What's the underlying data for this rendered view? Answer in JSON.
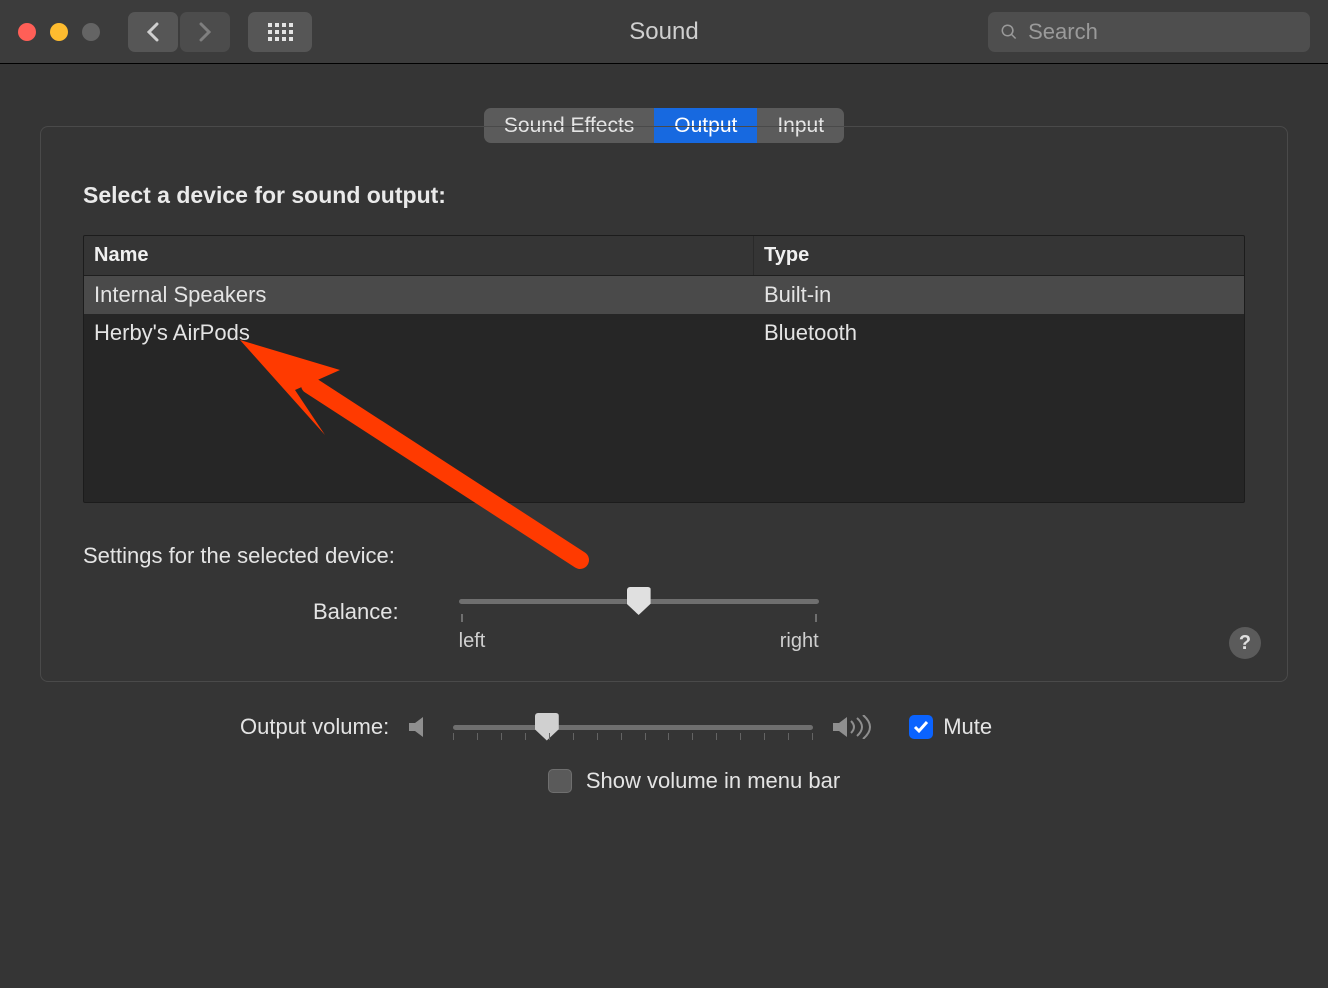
{
  "titlebar": {
    "title": "Sound",
    "search_placeholder": "Search"
  },
  "tabs": {
    "sound_effects": "Sound Effects",
    "output": "Output",
    "input": "Input"
  },
  "panel": {
    "select_device_heading": "Select a device for sound output:",
    "columns": {
      "name": "Name",
      "type": "Type"
    },
    "devices": [
      {
        "name": "Internal Speakers",
        "type": "Built-in",
        "selected": true
      },
      {
        "name": "Herby's AirPods",
        "type": "Bluetooth",
        "selected": false
      }
    ],
    "settings_heading": "Settings for the selected device:",
    "balance": {
      "label": "Balance:",
      "left": "left",
      "right": "right",
      "value": 0.5
    },
    "help": "?"
  },
  "footer": {
    "output_volume_label": "Output volume:",
    "volume_value": 0.26,
    "mute_label": "Mute",
    "mute_checked": true,
    "show_in_menubar_label": "Show volume in menu bar",
    "show_in_menubar_checked": false
  }
}
